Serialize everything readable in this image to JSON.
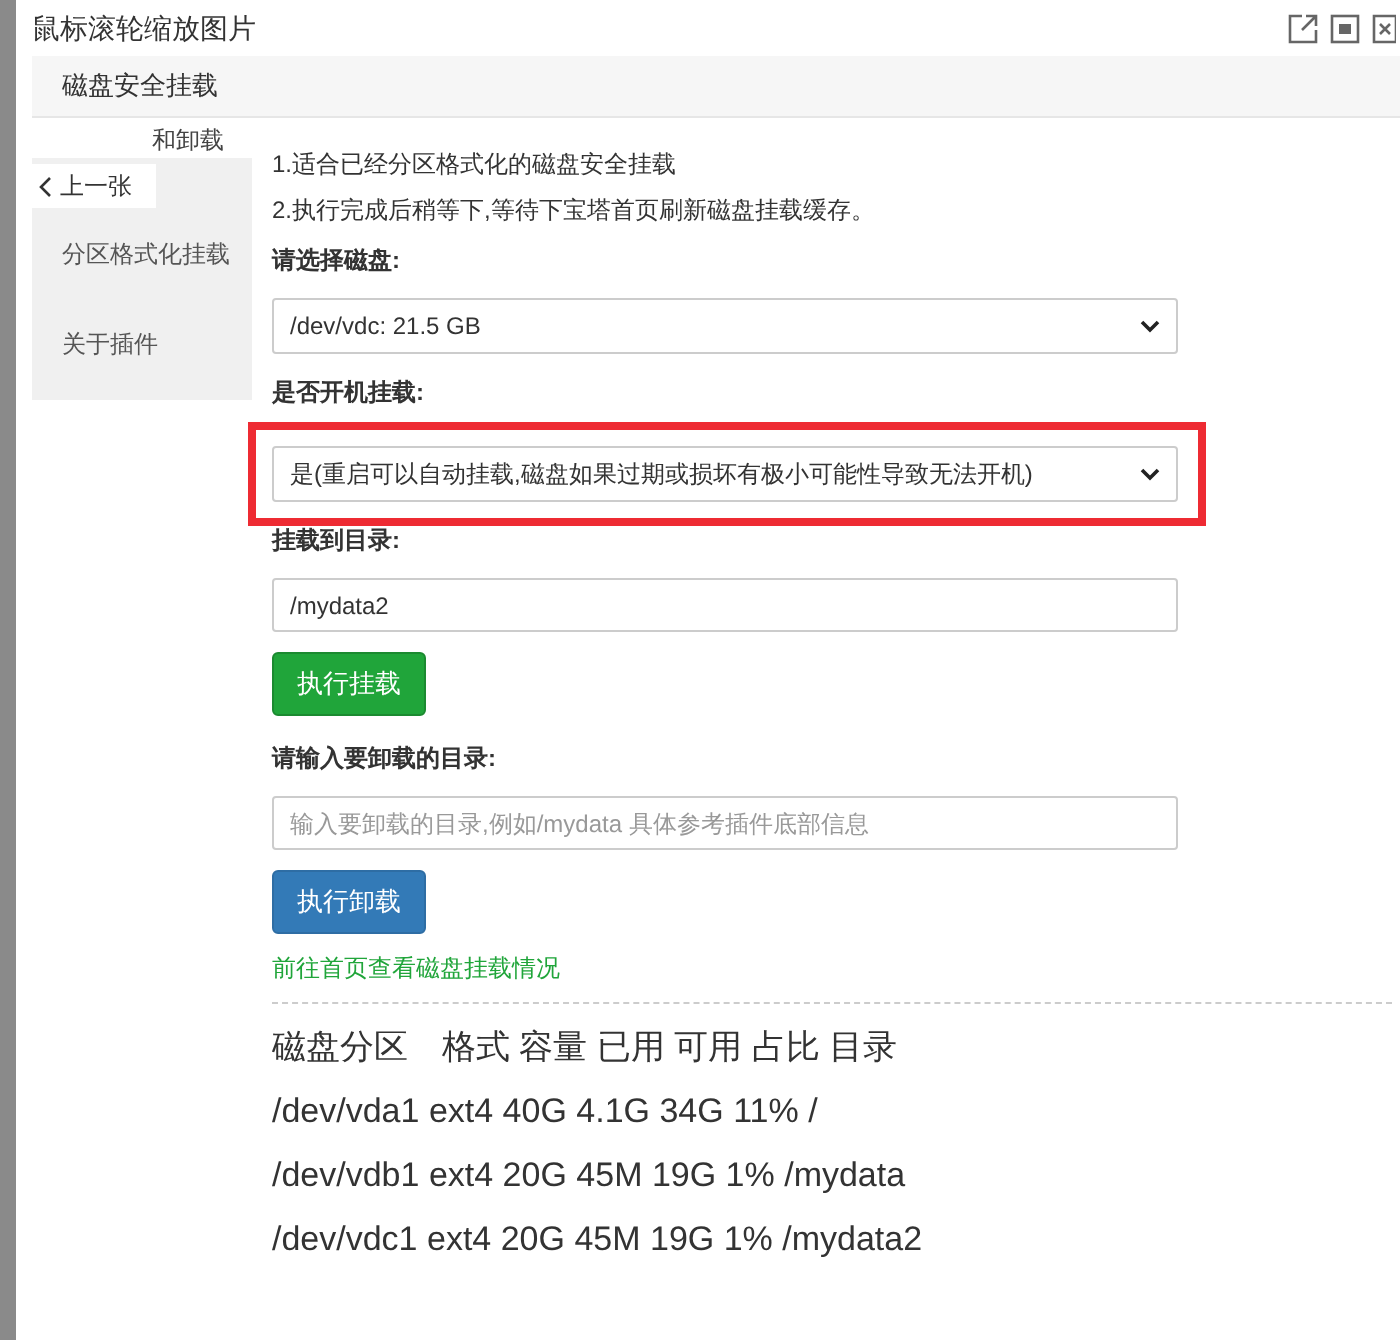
{
  "window": {
    "title": "鼠标滚轮缩放图片"
  },
  "header": {
    "title": "磁盘安全挂载"
  },
  "prev_button": {
    "label": "上一张"
  },
  "sidebar": {
    "items": [
      {
        "label": "和卸载"
      },
      {
        "label": "分区格式化挂载"
      },
      {
        "label": "关于插件"
      }
    ]
  },
  "notes": [
    "1.适合已经分区格式化的磁盘安全挂载",
    "2.执行完成后稍等下,等待下宝塔首页刷新磁盘挂载缓存。"
  ],
  "disk_select": {
    "label": "请选择磁盘:",
    "value": "/dev/vdc: 21.5 GB"
  },
  "boot_select": {
    "label": "是否开机挂载:",
    "value": "是(重启可以自动挂载,磁盘如果过期或损坏有极小可能性导致无法开机)",
    "highlighted": true
  },
  "mount_dir": {
    "label": "挂载到目录:",
    "value": "/mydata2"
  },
  "mount_button": {
    "label": "执行挂载"
  },
  "unmount_dir": {
    "label": "请输入要卸载的目录:",
    "placeholder": "输入要卸载的目录,例如/mydata 具体参考插件底部信息"
  },
  "unmount_button": {
    "label": "执行卸载"
  },
  "home_link": {
    "label": "前往首页查看磁盘挂载情况"
  },
  "partitions": {
    "header": "磁盘分区　格式 容量 已用 可用 占比 目录",
    "rows": [
      "/dev/vda1 ext4 40G 4.1G 34G 11% /",
      "/dev/vdb1 ext4 20G 45M 19G 1% /mydata",
      "/dev/vdc1 ext4 20G 45M 19G 1% /mydata2"
    ]
  }
}
